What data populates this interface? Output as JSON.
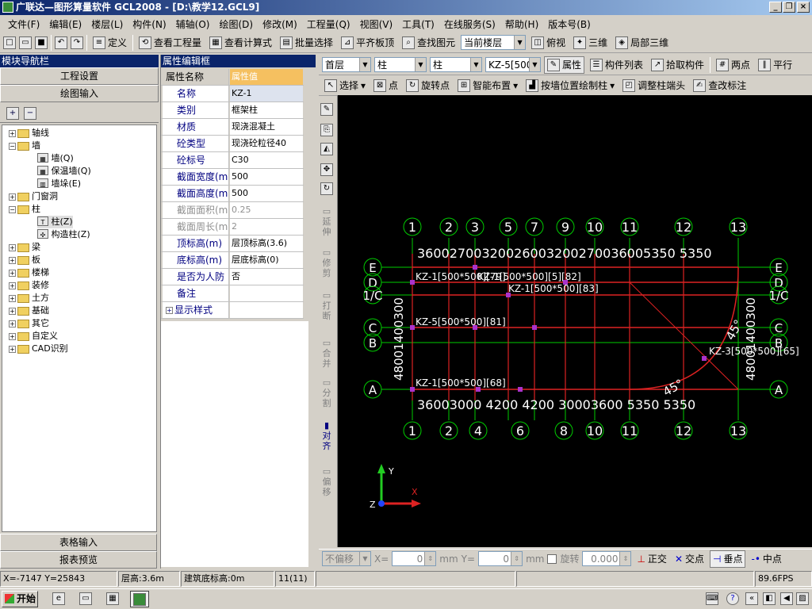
{
  "app": {
    "title": "广联达—图形算量软件  GCL2008 - [D:\\教学12.GCL9]"
  },
  "menu": [
    "文件(F)",
    "编辑(E)",
    "楼层(L)",
    "构件(N)",
    "辅轴(O)",
    "绘图(D)",
    "修改(M)",
    "工程量(Q)",
    "视图(V)",
    "工具(T)",
    "在线服务(S)",
    "帮助(H)",
    "版本号(B)"
  ],
  "toolbar1": {
    "define": "定义",
    "view_qty": "查看工程量",
    "view_formula": "查看计算式",
    "batch_select": "批量选择",
    "align_slab": "平齐板顶",
    "find_elem": "查找图元",
    "floor_combo": "当前楼层",
    "top_view": "俯视",
    "view3d": "三维",
    "local3d": "局部三维"
  },
  "toolbar2": {
    "floor": "首层",
    "type1": "柱",
    "type2": "柱",
    "comp": "KZ-5[500",
    "props": "属性",
    "comp_list": "构件列表",
    "pick": "拾取构件",
    "two_points": "两点",
    "parallel": "平行"
  },
  "toolbar3": {
    "select": "选择",
    "point": "点",
    "rotate_point": "旋转点",
    "smart_layout": "智能布置",
    "draw_by_wall": "按墙位置绘制柱",
    "adjust_col": "调整柱端头",
    "edit_label": "查改标注"
  },
  "nav": {
    "title": "模块导航栏",
    "proj_settings": "工程设置",
    "draw_input": "绘图输入",
    "table_input": "表格输入",
    "report": "报表预览",
    "tree": [
      "轴线",
      "墙",
      "墙(Q)",
      "保温墙(Q)",
      "墙垛(E)",
      "门窗洞",
      "柱",
      "柱(Z)",
      "构造柱(Z)",
      "梁",
      "板",
      "楼梯",
      "装修",
      "土方",
      "基础",
      "其它",
      "自定义",
      "CAD识别"
    ]
  },
  "props": {
    "title": "属性编辑框",
    "col_name": "属性名称",
    "col_val": "属性值",
    "rows": [
      [
        "名称",
        "KZ-1"
      ],
      [
        "类别",
        "框架柱"
      ],
      [
        "材质",
        "现浇混凝土"
      ],
      [
        "砼类型",
        "现浇砼粒径40"
      ],
      [
        "砼标号",
        "C30"
      ],
      [
        "截面宽度(m",
        "500"
      ],
      [
        "截面高度(m",
        "500"
      ],
      [
        "截面面积(m",
        "0.25"
      ],
      [
        "截面周长(m",
        "2"
      ],
      [
        "顶标高(m)",
        "层顶标高(3.6)"
      ],
      [
        "底标高(m)",
        "层底标高(0)"
      ],
      [
        "是否为人防",
        "否"
      ],
      [
        "备注",
        ""
      ],
      [
        "显示样式",
        ""
      ]
    ]
  },
  "vtools": [
    "延伸",
    "修剪",
    "打断",
    "合并",
    "分割",
    "对齐",
    "偏移"
  ],
  "cad": {
    "top_axes": [
      "1",
      "2",
      "3",
      "5",
      "7",
      "9",
      "10",
      "11",
      "12",
      "13"
    ],
    "bot_axes": [
      "1",
      "2",
      "4",
      "6",
      "8",
      "10",
      "11",
      "12",
      "13"
    ],
    "top_dims": "36002700320026003200270036005350  5350",
    "bot_dims": "36003000 4200  4200 30003600  5350  5350",
    "left_rows": [
      "E",
      "D",
      "1/C",
      "C",
      "B",
      "A"
    ],
    "right_rows": [
      "E",
      "D",
      "1/C",
      "C",
      "B",
      "A"
    ],
    "col_labels": [
      "KZ-1[500*500][79]",
      "KZ-1[500*500][5][82]",
      "KZ-1[500*500][83]",
      "KZ-5[500*500][81]",
      "KZ-3[500*500][65]",
      "KZ-1[500*500][68]"
    ],
    "angle": "45°",
    "side_dims": "48001400300"
  },
  "coordbar": {
    "mode": "不偏移",
    "x_lbl": "X=",
    "x_val": "0",
    "y_lbl": "Y=",
    "y_val": "0",
    "mm": "mm",
    "rot": "旋转",
    "rot_val": "0.000",
    "ortho": "正交",
    "intersect": "交点",
    "perp": "垂点",
    "mid": "中点"
  },
  "status": {
    "xy": "X=-7147 Y=25843",
    "floor_h": "层高:3.6m",
    "base_h": "建筑底标高:0m",
    "sel": "11(11)",
    "fps": "89.6FPS"
  },
  "taskbar": {
    "start": "开始"
  },
  "colors": {
    "axis": "#00cc00",
    "grid": "#dd2222",
    "text": "#ffffff"
  }
}
